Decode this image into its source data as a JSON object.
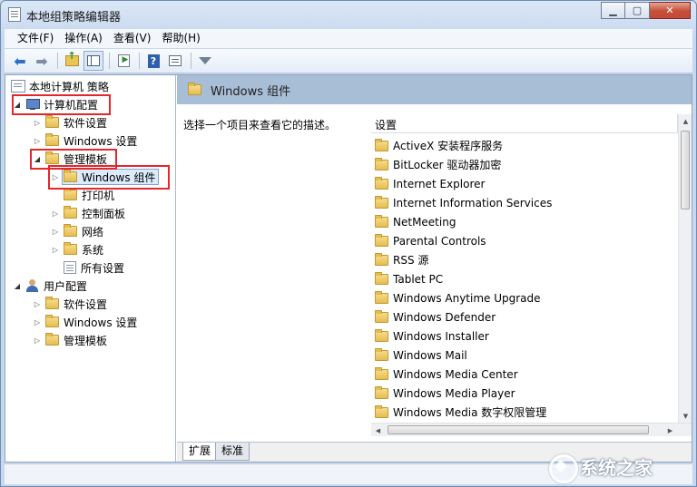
{
  "window": {
    "title": "本地组策略编辑器",
    "buttons": {
      "minimize": "▁",
      "maximize": "▢",
      "close": "✕"
    }
  },
  "menu": [
    "文件(F)",
    "操作(A)",
    "查看(V)",
    "帮助(H)"
  ],
  "toolbar": {
    "icons": [
      "back-arrow-icon",
      "forward-arrow-icon",
      "up-folder-icon",
      "show-hide-tree-icon",
      "export-list-icon",
      "help-icon",
      "properties-icon",
      "filter-icon"
    ],
    "glyphs": {
      "back": "⬅",
      "forward": "➡",
      "help": "?"
    }
  },
  "tree": {
    "root": "本地计算机 策略",
    "computer_config": "计算机配置",
    "cc_software": "软件设置",
    "cc_windows": "Windows 设置",
    "cc_admin": "管理模板",
    "windows_components": "Windows 组件",
    "printers": "打印机",
    "control_panel": "控制面板",
    "network": "网络",
    "system": "系统",
    "all_settings": "所有设置",
    "user_config": "用户配置",
    "uc_software": "软件设置",
    "uc_windows": "Windows 设置",
    "uc_admin": "管理模板",
    "glyphs": {
      "expanded": "◢",
      "collapsed": "▷"
    }
  },
  "details": {
    "header_title": "Windows 组件",
    "description": "选择一个项目来查看它的描述。",
    "column_header": "设置",
    "items": [
      "ActiveX 安装程序服务",
      "BitLocker 驱动器加密",
      "Internet Explorer",
      "Internet Information Services",
      "NetMeeting",
      "Parental Controls",
      "RSS 源",
      "Tablet PC",
      "Windows Anytime Upgrade",
      "Windows Defender",
      "Windows Installer",
      "Windows Mail",
      "Windows Media Center",
      "Windows Media Player",
      "Windows Media 数字权限管理"
    ],
    "scroll_glyphs": {
      "up": "▲",
      "down": "▼",
      "left": "◀",
      "right": "▶"
    }
  },
  "tabs": [
    "扩展",
    "标准"
  ],
  "watermark": "系统之家",
  "colors": {
    "annotation_red": "#e4262d",
    "header_bar": "#a8bdd6",
    "selection": "#dcebfc",
    "folder": "#e4bd52"
  }
}
